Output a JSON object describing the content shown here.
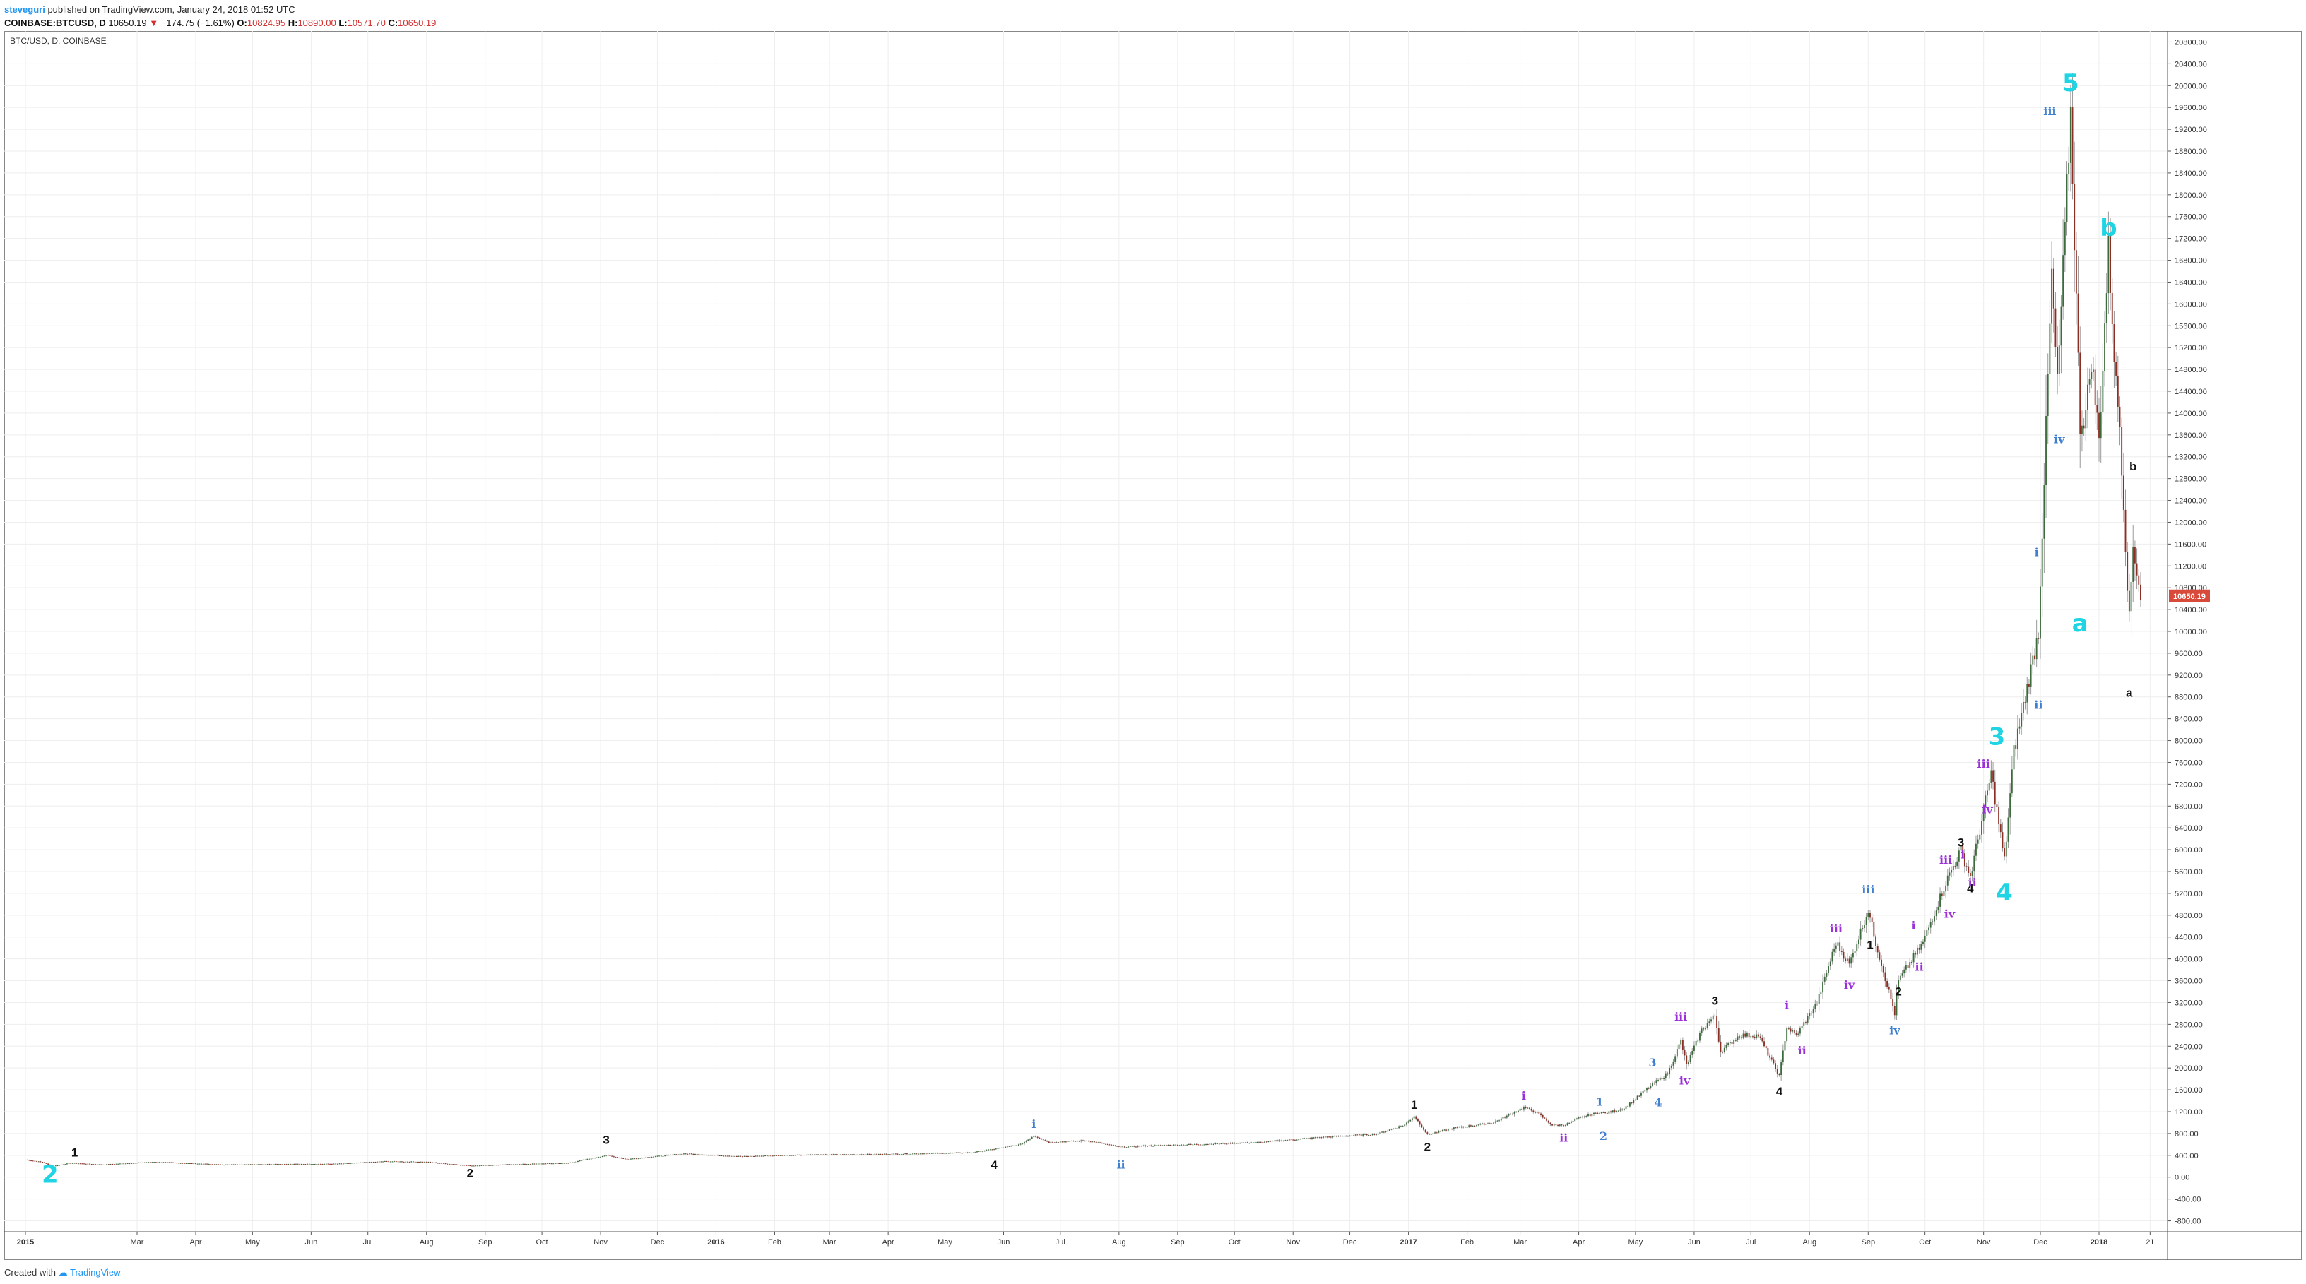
{
  "header": {
    "author": "steveguri",
    "published": "published on TradingView.com, January 24, 2018 01:52 UTC",
    "symbol": "COINBASE:BTCUSD, D",
    "last": "10650.19",
    "arrow": "▼",
    "change": "−174.75 (−1.61%)",
    "o_label": "O:",
    "o": "10824.95",
    "h_label": "H:",
    "h": "10890.00",
    "l_label": "L:",
    "l": "10571.70",
    "c_label": "C:",
    "c": "10650.19"
  },
  "footer": {
    "created": "Created with",
    "brand": "TradingView"
  },
  "colors": {
    "up": "#3d6b3d",
    "down": "#8b2f25",
    "grid": "#eeeeee",
    "axis": "#555555",
    "wave_big": "#1fd4e3",
    "wave_blue": "#3f7fd0",
    "wave_purple": "#9b30d9",
    "wave_black": "#111111",
    "price_tag": "#d84a3a"
  },
  "chart_data": {
    "type": "candlestick",
    "title": "BTC/USD, D, COINBASE",
    "x_range": [
      "2015-01-01",
      "2018-01-29"
    ],
    "ylim": [
      -1000,
      21000
    ],
    "y_ticks": [
      "-800.00",
      "-400.00",
      "0.00",
      "400.00",
      "800.00",
      "1200.00",
      "1600.00",
      "2000.00",
      "2400.00",
      "2800.00",
      "3200.00",
      "3600.00",
      "4000.00",
      "4400.00",
      "4800.00",
      "5200.00",
      "5600.00",
      "6000.00",
      "6400.00",
      "6800.00",
      "7200.00",
      "7600.00",
      "8000.00",
      "8400.00",
      "8800.00",
      "9200.00",
      "9600.00",
      "10000.00",
      "10400.00",
      "10800.00",
      "11200.00",
      "11600.00",
      "12000.00",
      "12400.00",
      "12800.00",
      "13200.00",
      "13600.00",
      "14000.00",
      "14400.00",
      "14800.00",
      "15200.00",
      "15600.00",
      "16000.00",
      "16400.00",
      "16800.00",
      "17200.00",
      "17600.00",
      "18000.00",
      "18400.00",
      "18800.00",
      "19200.00",
      "19600.00",
      "20000.00",
      "20400.00",
      "20800.00"
    ],
    "x_ticks": [
      {
        "date": "2015-01-01",
        "label": "2015",
        "bold": true
      },
      {
        "date": "2015-03-01",
        "label": "Mar"
      },
      {
        "date": "2015-04-01",
        "label": "Apr"
      },
      {
        "date": "2015-05-01",
        "label": "May"
      },
      {
        "date": "2015-06-01",
        "label": "Jun"
      },
      {
        "date": "2015-07-01",
        "label": "Jul"
      },
      {
        "date": "2015-08-01",
        "label": "Aug"
      },
      {
        "date": "2015-09-01",
        "label": "Sep"
      },
      {
        "date": "2015-10-01",
        "label": "Oct"
      },
      {
        "date": "2015-11-01",
        "label": "Nov"
      },
      {
        "date": "2015-12-01",
        "label": "Dec"
      },
      {
        "date": "2016-01-01",
        "label": "2016",
        "bold": true
      },
      {
        "date": "2016-02-01",
        "label": "Feb"
      },
      {
        "date": "2016-03-01",
        "label": "Mar"
      },
      {
        "date": "2016-04-01",
        "label": "Apr"
      },
      {
        "date": "2016-05-01",
        "label": "May"
      },
      {
        "date": "2016-06-01",
        "label": "Jun"
      },
      {
        "date": "2016-07-01",
        "label": "Jul"
      },
      {
        "date": "2016-08-01",
        "label": "Aug"
      },
      {
        "date": "2016-09-01",
        "label": "Sep"
      },
      {
        "date": "2016-10-01",
        "label": "Oct"
      },
      {
        "date": "2016-11-01",
        "label": "Nov"
      },
      {
        "date": "2016-12-01",
        "label": "Dec"
      },
      {
        "date": "2017-01-01",
        "label": "2017",
        "bold": true
      },
      {
        "date": "2017-02-01",
        "label": "Feb"
      },
      {
        "date": "2017-03-01",
        "label": "Mar"
      },
      {
        "date": "2017-04-01",
        "label": "Apr"
      },
      {
        "date": "2017-05-01",
        "label": "May"
      },
      {
        "date": "2017-06-01",
        "label": "Jun"
      },
      {
        "date": "2017-07-01",
        "label": "Jul"
      },
      {
        "date": "2017-08-01",
        "label": "Aug"
      },
      {
        "date": "2017-09-01",
        "label": "Sep"
      },
      {
        "date": "2017-10-01",
        "label": "Oct"
      },
      {
        "date": "2017-11-01",
        "label": "Nov"
      },
      {
        "date": "2017-12-01",
        "label": "Dec"
      },
      {
        "date": "2018-01-01",
        "label": "2018",
        "bold": true
      },
      {
        "date": "2018-01-28",
        "label": "21"
      }
    ],
    "price_path": [
      [
        "2015-01-01",
        320
      ],
      [
        "2015-01-10",
        275
      ],
      [
        "2015-01-15",
        200
      ],
      [
        "2015-01-25",
        260
      ],
      [
        "2015-02-10",
        230
      ],
      [
        "2015-03-10",
        280
      ],
      [
        "2015-04-15",
        230
      ],
      [
        "2015-05-15",
        240
      ],
      [
        "2015-06-15",
        245
      ],
      [
        "2015-07-10",
        290
      ],
      [
        "2015-08-01",
        280
      ],
      [
        "2015-08-24",
        210
      ],
      [
        "2015-09-15",
        235
      ],
      [
        "2015-10-15",
        260
      ],
      [
        "2015-11-04",
        400
      ],
      [
        "2015-11-15",
        330
      ],
      [
        "2015-12-15",
        430
      ],
      [
        "2016-01-15",
        380
      ],
      [
        "2016-02-15",
        410
      ],
      [
        "2016-03-15",
        415
      ],
      [
        "2016-04-15",
        430
      ],
      [
        "2016-05-15",
        450
      ],
      [
        "2016-05-28",
        520
      ],
      [
        "2016-06-10",
        600
      ],
      [
        "2016-06-17",
        760
      ],
      [
        "2016-06-25",
        640
      ],
      [
        "2016-07-15",
        670
      ],
      [
        "2016-08-02",
        550
      ],
      [
        "2016-08-15",
        575
      ],
      [
        "2016-09-15",
        605
      ],
      [
        "2016-10-15",
        640
      ],
      [
        "2016-11-15",
        730
      ],
      [
        "2016-12-15",
        790
      ],
      [
        "2016-12-30",
        960
      ],
      [
        "2017-01-04",
        1120
      ],
      [
        "2017-01-11",
        780
      ],
      [
        "2017-01-25",
        900
      ],
      [
        "2017-02-15",
        1000
      ],
      [
        "2017-03-03",
        1280
      ],
      [
        "2017-03-10",
        1180
      ],
      [
        "2017-03-18",
        950
      ],
      [
        "2017-03-25",
        960
      ],
      [
        "2017-04-01",
        1080
      ],
      [
        "2017-04-12",
        1190
      ],
      [
        "2017-04-15",
        1170
      ],
      [
        "2017-04-25",
        1260
      ],
      [
        "2017-05-10",
        1700
      ],
      [
        "2017-05-18",
        1900
      ],
      [
        "2017-05-25",
        2500
      ],
      [
        "2017-05-28",
        2050
      ],
      [
        "2017-06-05",
        2700
      ],
      [
        "2017-06-12",
        2960
      ],
      [
        "2017-06-15",
        2300
      ],
      [
        "2017-06-25",
        2600
      ],
      [
        "2017-07-05",
        2600
      ],
      [
        "2017-07-16",
        1850
      ],
      [
        "2017-07-20",
        2750
      ],
      [
        "2017-07-25",
        2600
      ],
      [
        "2017-08-05",
        3200
      ],
      [
        "2017-08-15",
        4300
      ],
      [
        "2017-08-22",
        3900
      ],
      [
        "2017-09-01",
        4900
      ],
      [
        "2017-09-05",
        4300
      ],
      [
        "2017-09-15",
        3000
      ],
      [
        "2017-09-17",
        3600
      ],
      [
        "2017-09-30",
        4300
      ],
      [
        "2017-10-12",
        5400
      ],
      [
        "2017-10-20",
        6000
      ],
      [
        "2017-10-25",
        5500
      ],
      [
        "2017-11-05",
        7400
      ],
      [
        "2017-11-12",
        5800
      ],
      [
        "2017-11-17",
        7800
      ],
      [
        "2017-11-26",
        9300
      ],
      [
        "2017-11-30",
        10000
      ],
      [
        "2017-12-07",
        16500
      ],
      [
        "2017-12-10",
        14500
      ],
      [
        "2017-12-17",
        19500
      ],
      [
        "2017-12-22",
        13800
      ],
      [
        "2017-12-25",
        14000
      ],
      [
        "2017-12-28",
        15000
      ],
      [
        "2018-01-01",
        13500
      ],
      [
        "2018-01-06",
        17000
      ],
      [
        "2018-01-10",
        14500
      ],
      [
        "2018-01-12",
        13800
      ],
      [
        "2018-01-17",
        10200
      ],
      [
        "2018-01-19",
        11600
      ],
      [
        "2018-01-23",
        10650
      ]
    ],
    "waves": [
      {
        "label": "2",
        "date": "2015-01-14",
        "price": -100,
        "style": "big"
      },
      {
        "label": "1",
        "date": "2015-01-27",
        "price": 380,
        "style": "black"
      },
      {
        "label": "2",
        "date": "2015-08-24",
        "price": 0,
        "style": "black"
      },
      {
        "label": "3",
        "date": "2015-11-04",
        "price": 610,
        "style": "black"
      },
      {
        "label": "4",
        "date": "2016-05-27",
        "price": 150,
        "style": "black"
      },
      {
        "label": "i",
        "date": "2016-06-17",
        "price": 900,
        "style": "blue"
      },
      {
        "label": "ii",
        "date": "2016-08-02",
        "price": 160,
        "style": "blue"
      },
      {
        "label": "1",
        "date": "2017-01-04",
        "price": 1250,
        "style": "black"
      },
      {
        "label": "2",
        "date": "2017-01-11",
        "price": 480,
        "style": "black"
      },
      {
        "label": "i",
        "date": "2017-03-03",
        "price": 1420,
        "style": "purple"
      },
      {
        "label": "ii",
        "date": "2017-03-24",
        "price": 650,
        "style": "purple"
      },
      {
        "label": "1",
        "date": "2017-04-12",
        "price": 1310,
        "style": "blue"
      },
      {
        "label": "2",
        "date": "2017-04-14",
        "price": 680,
        "style": "blue"
      },
      {
        "label": "3",
        "date": "2017-05-10",
        "price": 2030,
        "style": "blue"
      },
      {
        "label": "4",
        "date": "2017-05-13",
        "price": 1300,
        "style": "blue"
      },
      {
        "label": "iii",
        "date": "2017-05-25",
        "price": 2870,
        "style": "purple"
      },
      {
        "label": "iv",
        "date": "2017-05-27",
        "price": 1700,
        "style": "purple"
      },
      {
        "label": "3",
        "date": "2017-06-12",
        "price": 3160,
        "style": "black"
      },
      {
        "label": "4",
        "date": "2017-07-16",
        "price": 1500,
        "style": "black"
      },
      {
        "label": "i",
        "date": "2017-07-20",
        "price": 3080,
        "style": "purple"
      },
      {
        "label": "ii",
        "date": "2017-07-28",
        "price": 2250,
        "style": "purple"
      },
      {
        "label": "iii",
        "date": "2017-08-15",
        "price": 4490,
        "style": "purple"
      },
      {
        "label": "iv",
        "date": "2017-08-22",
        "price": 3450,
        "style": "purple"
      },
      {
        "label": "iii",
        "date": "2017-09-01",
        "price": 5200,
        "style": "blue"
      },
      {
        "label": "1",
        "date": "2017-09-02",
        "price": 4180,
        "style": "black"
      },
      {
        "label": "iv",
        "date": "2017-09-15",
        "price": 2620,
        "style": "blue"
      },
      {
        "label": "2",
        "date": "2017-09-17",
        "price": 3330,
        "style": "black"
      },
      {
        "label": "i",
        "date": "2017-09-25",
        "price": 4540,
        "style": "purple"
      },
      {
        "label": "ii",
        "date": "2017-09-28",
        "price": 3780,
        "style": "purple"
      },
      {
        "label": "iii",
        "date": "2017-10-12",
        "price": 5740,
        "style": "purple"
      },
      {
        "label": "iv",
        "date": "2017-10-14",
        "price": 4750,
        "style": "purple"
      },
      {
        "label": "3",
        "date": "2017-10-20",
        "price": 6060,
        "style": "black"
      },
      {
        "label": "i",
        "date": "2017-10-21",
        "price": 5840,
        "style": "purple"
      },
      {
        "label": "4",
        "date": "2017-10-25",
        "price": 5220,
        "style": "black"
      },
      {
        "label": "ii",
        "date": "2017-10-26",
        "price": 5330,
        "style": "purple"
      },
      {
        "label": "iii",
        "date": "2017-11-01",
        "price": 7500,
        "style": "purple"
      },
      {
        "label": "iv",
        "date": "2017-11-03",
        "price": 6670,
        "style": "purple"
      },
      {
        "label": "3",
        "date": "2017-11-08",
        "price": 7920,
        "style": "big"
      },
      {
        "label": "4",
        "date": "2017-11-12",
        "price": 5070,
        "style": "big"
      },
      {
        "label": "i",
        "date": "2017-11-29",
        "price": 11380,
        "style": "blue"
      },
      {
        "label": "ii",
        "date": "2017-11-30",
        "price": 8580,
        "style": "blue"
      },
      {
        "label": "iii",
        "date": "2017-12-06",
        "price": 19460,
        "style": "blue"
      },
      {
        "label": "iv",
        "date": "2017-12-11",
        "price": 13450,
        "style": "blue"
      },
      {
        "label": "5",
        "date": "2017-12-17",
        "price": 19900,
        "style": "big"
      },
      {
        "label": "a",
        "date": "2017-12-22",
        "price": 10000,
        "style": "big"
      },
      {
        "label": "b",
        "date": "2018-01-06",
        "price": 17250,
        "style": "big"
      },
      {
        "label": "b",
        "date": "2018-01-19",
        "price": 12950,
        "style": "black"
      },
      {
        "label": "a",
        "date": "2018-01-17",
        "price": 8800,
        "style": "black"
      }
    ],
    "price_tag": "10650.19"
  }
}
